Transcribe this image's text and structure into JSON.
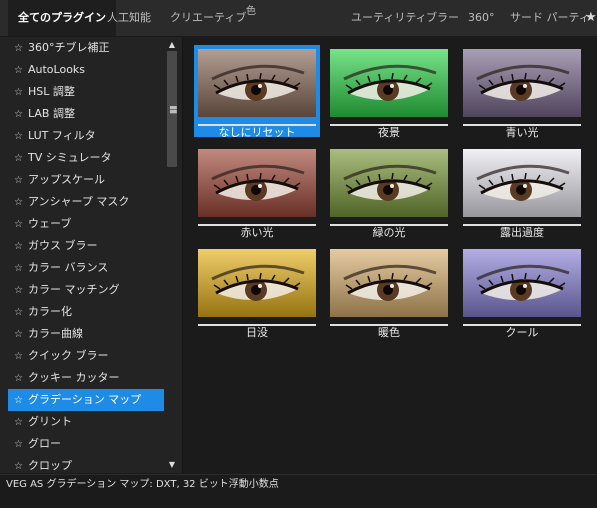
{
  "tabs": [
    {
      "label": "全てのプラグイン",
      "active": true
    },
    {
      "label": "人工知能"
    },
    {
      "label": "クリエーティブ"
    },
    {
      "label": "色"
    },
    {
      "label": "ユーティリティ"
    },
    {
      "label": "ブラー"
    },
    {
      "label": "360°"
    },
    {
      "label": "サード パーティ"
    }
  ],
  "favorite_icon": "star-icon",
  "plugins": [
    "360°チブレ補正",
    "AutoLooks",
    "HSL 調整",
    "LAB 調整",
    "LUT フィルタ",
    "TV シミュレータ",
    "アップスケール",
    "アンシャープ マスク",
    "ウェーブ",
    "ガウス ブラー",
    "カラー バランス",
    "カラー マッチング",
    "カラー化",
    "カラー曲線",
    "クイック ブラー",
    "クッキー カッター",
    "グラデーション マップ",
    "グリント",
    "グロー",
    "クロップ"
  ],
  "selected_plugin_index": 16,
  "presets": [
    {
      "label": "なしにリセット",
      "tint": "#8a6a5a",
      "selected": true
    },
    {
      "label": "夜景",
      "tint": "#2fd44a"
    },
    {
      "label": "青い光",
      "tint": "#7a6a8e"
    },
    {
      "label": "赤い光",
      "tint": "#a04a3a"
    },
    {
      "label": "緑の光",
      "tint": "#7a9a3a"
    },
    {
      "label": "露出過度",
      "tint": "#e8e8f0"
    },
    {
      "label": "日没",
      "tint": "#e6b21a"
    },
    {
      "label": "暖色",
      "tint": "#d9b070"
    },
    {
      "label": "クール",
      "tint": "#8a84d8"
    }
  ],
  "status": "VEG AS グラデーション マップ: DXT, 32 ビット浮動小数点",
  "colors": {
    "accent": "#1e8ce6",
    "background": "#1b1b1b",
    "panel": "#232323"
  }
}
